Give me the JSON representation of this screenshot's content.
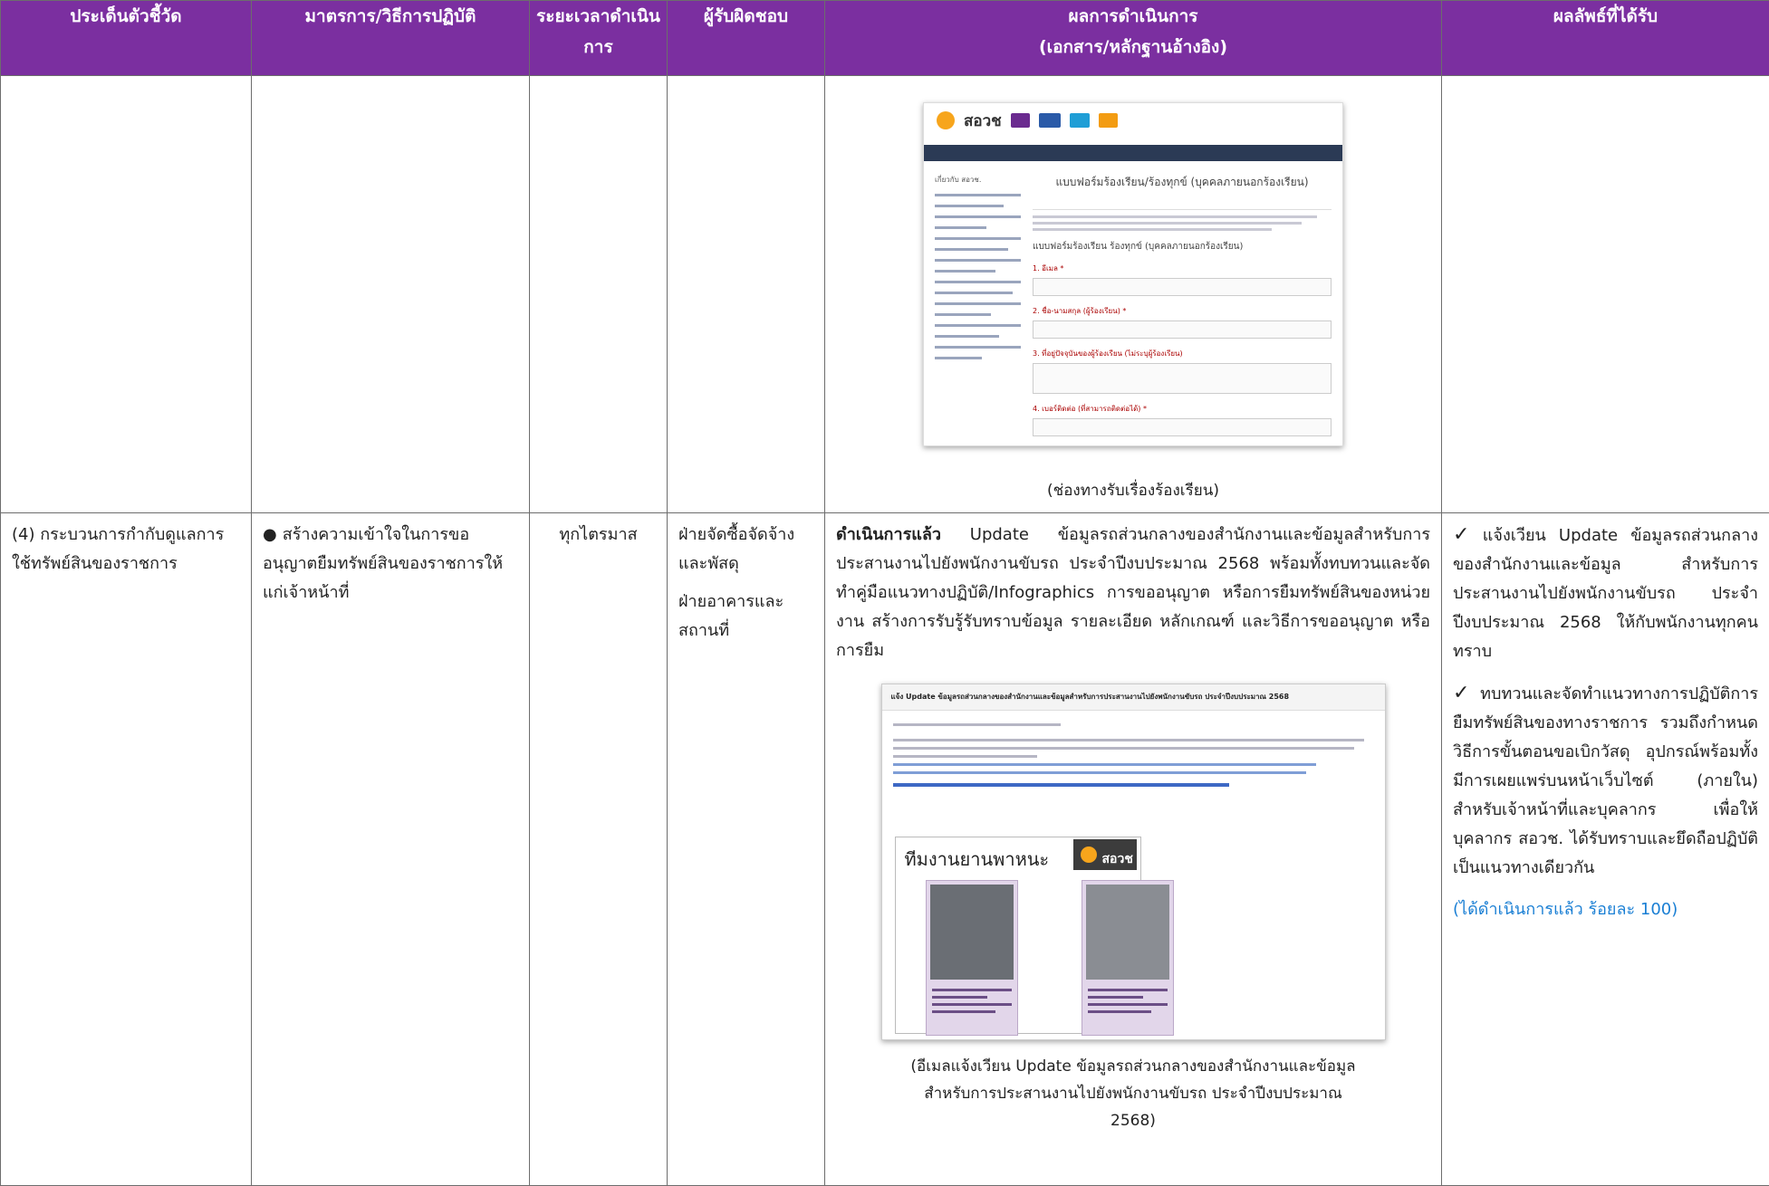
{
  "headers": {
    "indicator": "ประเด็นตัวชี้วัด",
    "measures": "มาตรการ/วิธีการปฏิบัติ",
    "period": "ระยะเวลาดำเนินการ",
    "responsible": "ผู้รับผิดชอบ",
    "results": "ผลการดำเนินการ\n(เอกสาร/หลักฐานอ้างอิง)",
    "outcome": "ผลลัพธ์ที่ได้รับ"
  },
  "row1": {
    "caption": "(ช่องทางรับเรื่องร้องเรียน)",
    "screenshot": {
      "logo": "สอวช",
      "form_title": "แบบฟอร์มร้องเรียน/ร้องทุกข์ (บุคคลภายนอกร้องเรียน)",
      "form_subtitle": "แบบฟอร์มร้องเรียน ร้องทุกข์ (บุคคลภายนอกร้องเรียน)",
      "sidebar_heading": "เกี่ยวกับ สอวช.",
      "fields": [
        "1. อีเมล *",
        "2. ชื่อ-นามสกุล (ผู้ร้องเรียน) *",
        "3. ที่อยู่ปัจจุบันของผู้ร้องเรียน (ไม่ระบุผู้ร้องเรียน)",
        "4. เบอร์ติดต่อ (ที่สามารถติดต่อได้) *"
      ]
    }
  },
  "row2": {
    "indicator": "(4) กระบวนการกำกับดูแลการใช้ทรัพย์สินของราชการ",
    "measure": "สร้างความเข้าใจในการขออนุญาตยืมทรัพย์สินของราชการให้แก่เจ้าหน้าที่",
    "period": "ทุกไตรมาส",
    "responsible": [
      "ฝ่ายจัดซื้อจัดจ้างและพัสดุ",
      "ฝ่ายอาคารและสถานที่"
    ],
    "result_bold": "ดำเนินการแล้ว",
    "result_text": " Update ข้อมูลรถส่วนกลางของสำนักงานและข้อมูลสำหรับการประสานงานไปยังพนักงานขับรถ ประจำปีงบประมาณ 2568 พร้อมทั้งทบทวนและจัดทำคู่มือแนวทางปฏิบัติ/Infographics การขออนุญาต หรือการยืมทรัพย์สินของหน่วยงาน สร้างการรับรู้รับทราบข้อมูล รายละเอียด หลักเกณฑ์ และวิธีการขออนุญาต หรือการยืม",
    "caption": "(อีเมลแจ้งเวียน Update ข้อมูลรถส่วนกลางของสำนักงานและข้อมูลสำหรับการประสานงานไปยังพนักงานขับรถ ประจำปีงบประมาณ 2568)",
    "email": {
      "subject": "แจ้ง Update ข้อมูลรถส่วนกลางของสำนักงานและข้อมูลสำหรับการประสานงานไปยังพนักงานขับรถ ประจำปีงบประมาณ 2568",
      "card_title": "ทีมงานยานพาหนะ",
      "logo": "สอวช"
    },
    "outcomes": [
      "แจ้งเวียน Update ข้อมูลรถส่วนกลางของสำนักงานและข้อมูล สำหรับการประสานงานไปยังพนักงานขับรถ ประจำปีงบประมาณ 2568 ให้กับพนักงานทุกคนทราบ",
      "ทบทวนและจัดทำแนวทางการปฏิบัติการยืมทรัพย์สินของทางราชการ รวมถึงกำหนดวิธีการขั้นตอนขอเบิกวัสดุ อุปกรณ์พร้อมทั้งมีการเผยแพร่บนหน้าเว็บไซต์ (ภายใน) สำหรับเจ้าหน้าที่และบุคลากร เพื่อให้บุคลากร สอวช. ได้รับทราบและยึดถือปฏิบัติเป็นแนวทางเดียวกัน"
    ],
    "status": "(ได้ดำเนินการแล้ว ร้อยละ 100)",
    "check_mark": "✓"
  },
  "colors": {
    "header_bg": "#7b2fa0",
    "status_text": "#1a7fd4"
  }
}
